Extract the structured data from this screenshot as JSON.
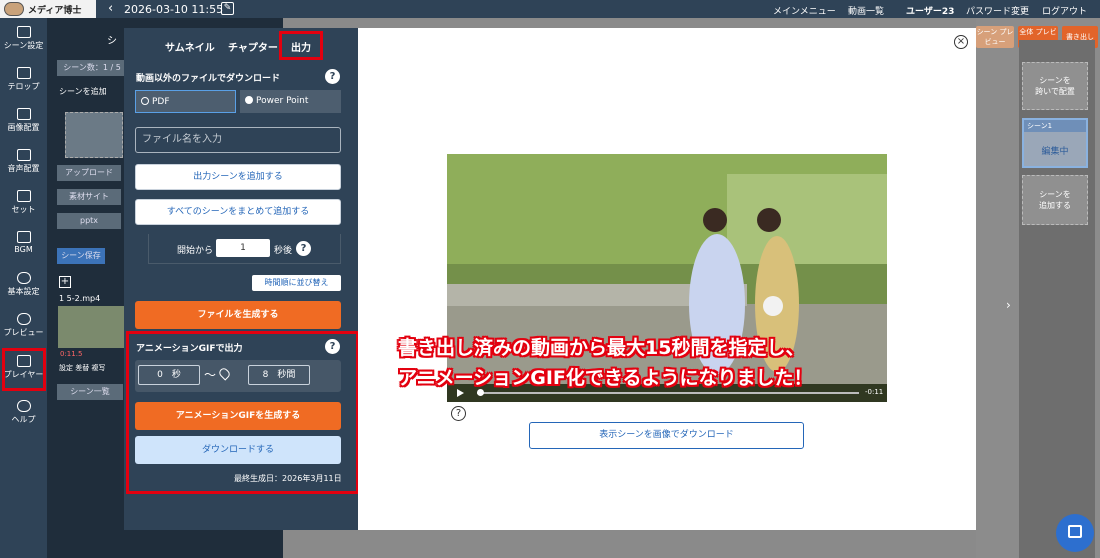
{
  "app": {
    "logo_text": "メディア博士",
    "date": "2026-03-10 11:55"
  },
  "nav": {
    "main_menu": "メインメニュー",
    "videos": "動画一覧",
    "user": "ユーザー23",
    "password": "パスワード変更",
    "logout": "ログアウト"
  },
  "sidebar": {
    "items": [
      {
        "label": "シーン設定"
      },
      {
        "label": "テロップ"
      },
      {
        "label": "画像配置"
      },
      {
        "label": "音声配置"
      },
      {
        "label": "セット"
      },
      {
        "label": "BGM"
      },
      {
        "label": "基本設定"
      },
      {
        "label": "プレビュー"
      },
      {
        "label": "プレイヤー"
      },
      {
        "label": "ヘルプ"
      }
    ]
  },
  "underpanel": {
    "tab": "シ",
    "scene_count": "シーン数：1 / 5",
    "add_scene": "シーンを追加",
    "upload": "アップロード",
    "material": "素材サイト",
    "pptx": "pptx",
    "scene_save": "シーン保存",
    "file_name": "1 5-2.mp4",
    "thumb_time": "0:11.5",
    "thumb_actions": "設定 差替 複写",
    "scene_delete": "シーン一覧"
  },
  "right": {
    "scene_preview": "シーン\nプレビュー",
    "full_preview": "全体\nプレビュー",
    "write_out": "書き出し",
    "move_scene": "シーンを\n跨いで配置",
    "scene1": "シーン1",
    "editing": "編集中",
    "add_scene": "シーンを\n追加する"
  },
  "modal": {
    "tabs": {
      "thumbnail": "サムネイル",
      "chapter": "チャプター",
      "output": "出力"
    },
    "download_section": "動画以外のファイルでダウンロード",
    "pdf": "PDF",
    "powerpoint": "Power Point",
    "filename_placeholder": "ファイル名を入力",
    "add_output_scene": "出力シーンを追加する",
    "add_all_scenes": "すべてのシーンをまとめて追加する",
    "start_from": "開始から",
    "start_value": "1",
    "seconds_after": "秒後",
    "sort_time": "時間順に並び替え",
    "generate_file": "ファイルを生成する",
    "gif_section": "アニメーションGIFで出力",
    "gif_start": "0",
    "gif_start_unit": "秒",
    "gif_end": "8",
    "gif_end_unit": "秒間",
    "generate_gif": "アニメーションGIFを生成する",
    "download": "ダウンロードする",
    "last_generated": "最終生成日：2026年3月11日",
    "video_time": "-0:11",
    "download_image": "表示シーンを画像でダウンロード",
    "annotation_line1": "書き出し済みの動画から最大15秒間を指定し、",
    "annotation_line2": "アニメーションGIF化できるようになりました！"
  },
  "colors": {
    "navy": "#2f4357",
    "orange": "#f06b23",
    "highlight_red": "#e3000f",
    "link_blue": "#2466b8"
  }
}
